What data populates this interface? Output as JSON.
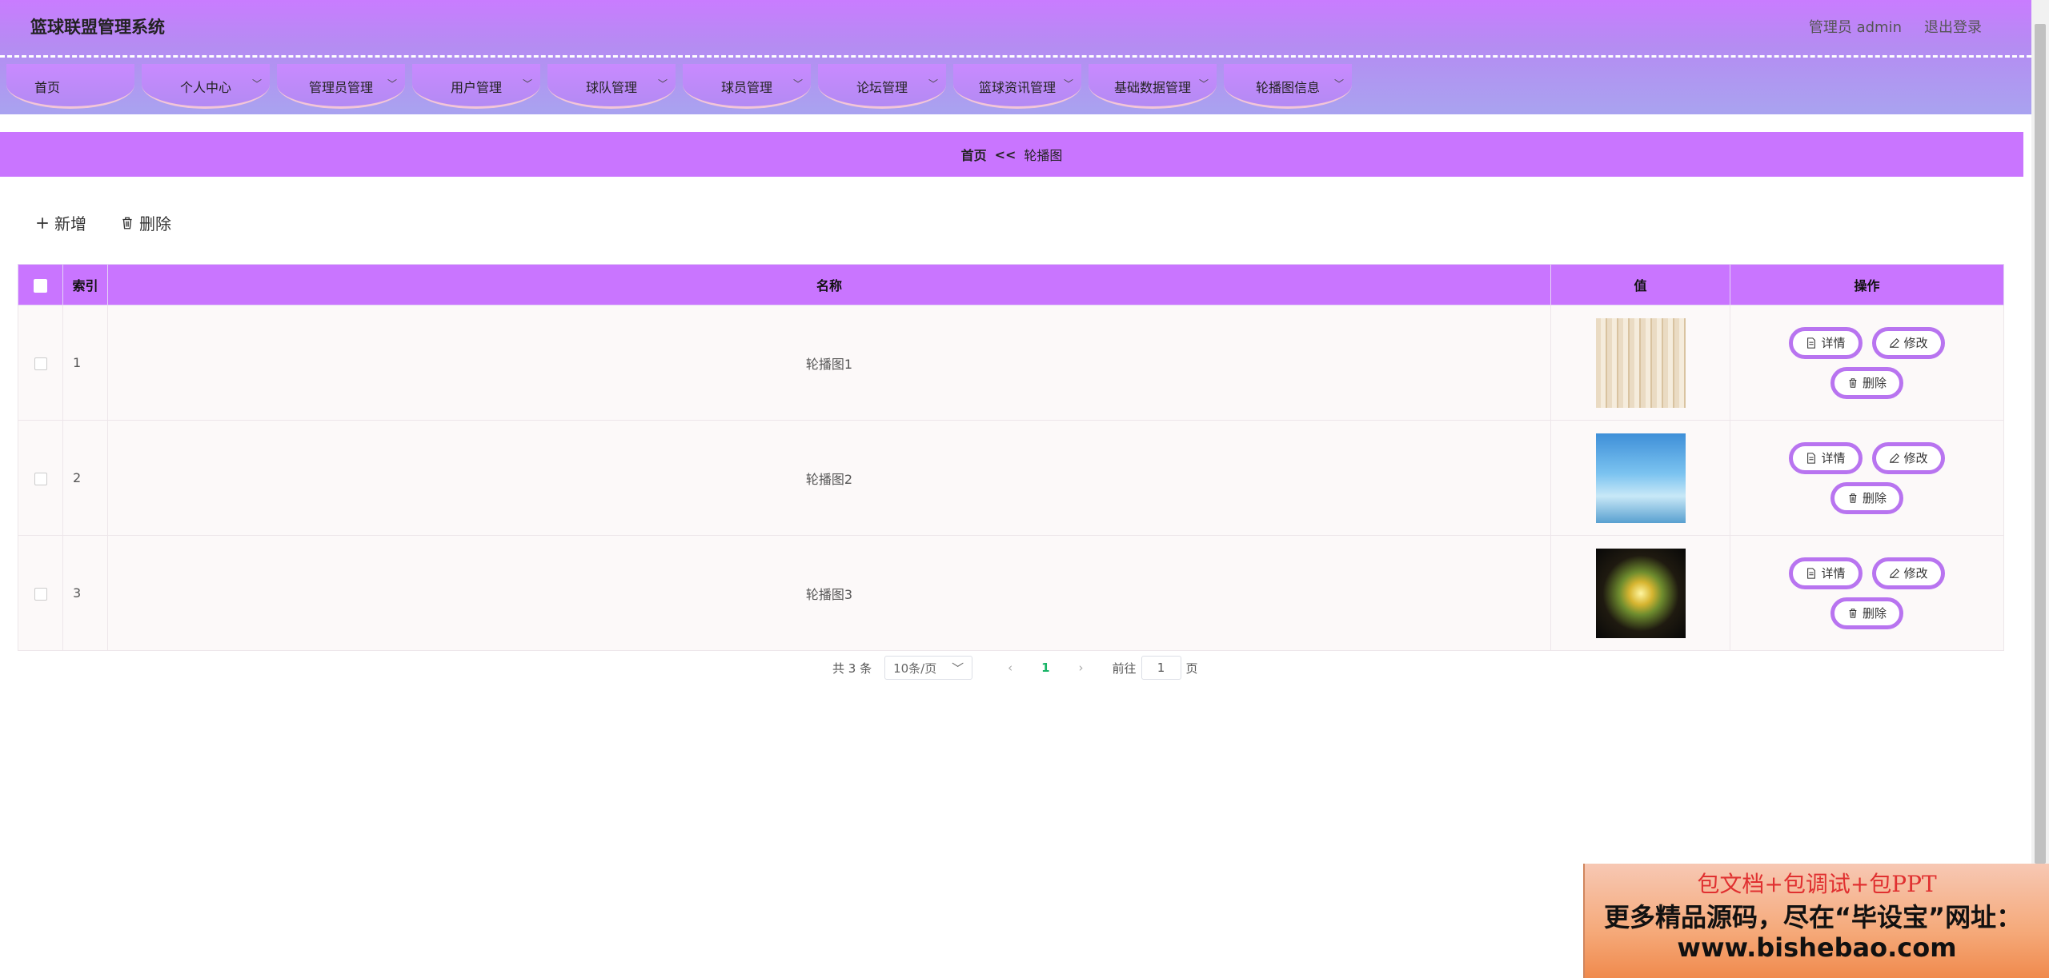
{
  "header": {
    "app_title": "篮球联盟管理系统",
    "user_label": "管理员 admin",
    "logout_label": "退出登录"
  },
  "nav": {
    "items": [
      {
        "label": "首页",
        "has_dropdown": false
      },
      {
        "label": "个人中心",
        "has_dropdown": true
      },
      {
        "label": "管理员管理",
        "has_dropdown": true
      },
      {
        "label": "用户管理",
        "has_dropdown": true
      },
      {
        "label": "球队管理",
        "has_dropdown": true
      },
      {
        "label": "球员管理",
        "has_dropdown": true
      },
      {
        "label": "论坛管理",
        "has_dropdown": true
      },
      {
        "label": "篮球资讯管理",
        "has_dropdown": true
      },
      {
        "label": "基础数据管理",
        "has_dropdown": true
      },
      {
        "label": "轮播图信息",
        "has_dropdown": true
      }
    ]
  },
  "breadcrumb": {
    "home": "首页",
    "separator": "<<",
    "current": "轮播图"
  },
  "toolbar": {
    "add_label": "新增",
    "delete_label": "删除"
  },
  "table": {
    "headers": {
      "index": "索引",
      "name": "名称",
      "value": "值",
      "actions": "操作"
    },
    "rows": [
      {
        "index": "1",
        "name": "轮播图1",
        "thumb": "thumb1"
      },
      {
        "index": "2",
        "name": "轮播图2",
        "thumb": "thumb2"
      },
      {
        "index": "3",
        "name": "轮播图3",
        "thumb": "thumb3"
      }
    ],
    "row_actions": {
      "detail": "详情",
      "edit": "修改",
      "delete": "删除"
    }
  },
  "pagination": {
    "total": "共 3 条",
    "page_size": "10条/页",
    "current_page": "1",
    "goto_prefix": "前往",
    "goto_value": "1",
    "goto_suffix": "页"
  },
  "ad": {
    "line1": "包文档+包调试+包PPT",
    "line2": "更多精品源码，尽在“毕设宝”网址：",
    "line3": "www.bishebao.com"
  },
  "colors": {
    "accent": "#c975ff",
    "button_border": "#b874f0",
    "active_page": "#18b466"
  }
}
